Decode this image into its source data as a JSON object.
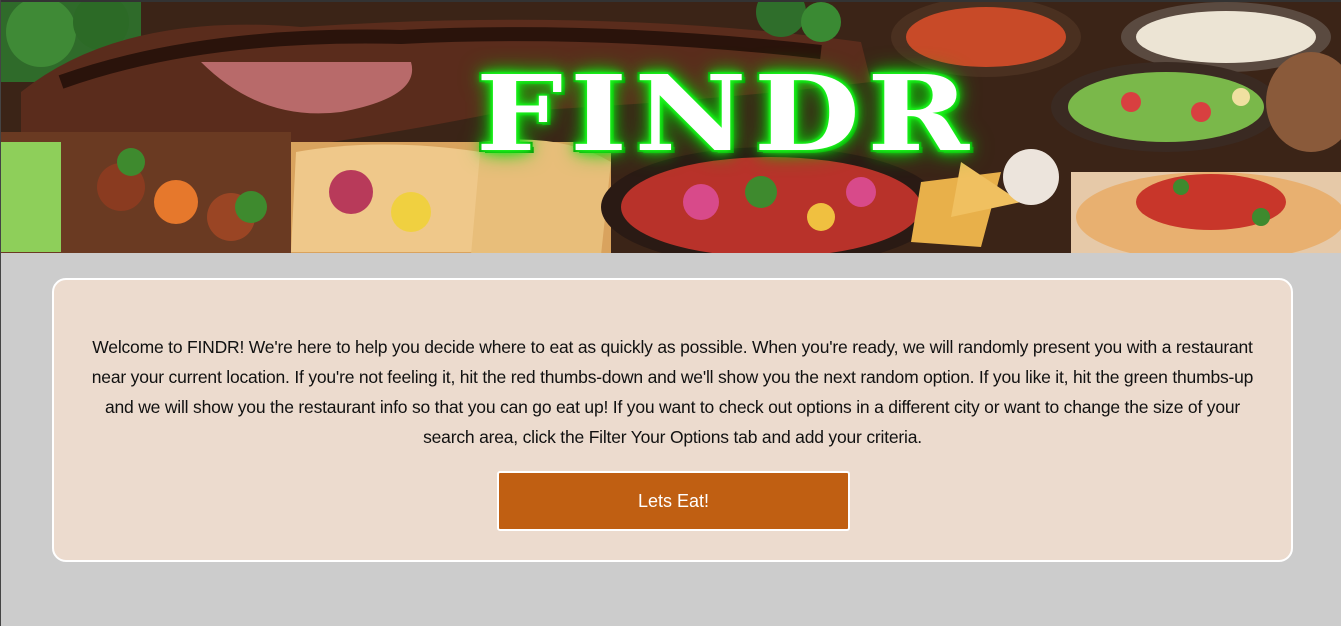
{
  "header": {
    "logo_text": "FINDR"
  },
  "intro": {
    "text": "Welcome to FINDR! We're here to help you decide where to eat as quickly as possible. When you're ready, we will randomly present you with a restaurant near your current location. If you're not feeling it, hit the red thumbs-down and we'll show you the next random option. If you like it, hit the green thumbs-up and we will show you the restaurant info so that you can go eat up! If you want to check out options in a different city or want to change the size of your search area, click the Filter Your Options tab and add your criteria."
  },
  "cta": {
    "label": "Lets Eat!"
  },
  "colors": {
    "page_background": "#cccccc",
    "card_background": "#ecdbce",
    "button_background": "#c05f12",
    "logo_glow": "#22ff22"
  }
}
